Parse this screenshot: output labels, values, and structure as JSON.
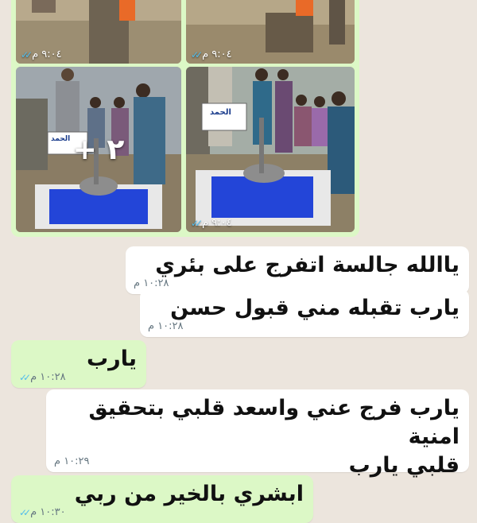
{
  "media": {
    "tiles": [
      {
        "time": "٩:٠٤ م"
      },
      {
        "time": "٩:٠٤ م"
      },
      {
        "time": "",
        "sign_text": "الحمد",
        "more_count": "+ ٢"
      },
      {
        "time": "٩:٠٤ م",
        "sign_text": "الحمد"
      }
    ]
  },
  "messages": [
    {
      "direction": "incoming",
      "text": "ياالله جالسة اتفرج على بئري",
      "time": "١٠:٢٨ م"
    },
    {
      "direction": "incoming",
      "text": "يارب تقبله مني قبول حسن",
      "time": "١٠:٢٨ م"
    },
    {
      "direction": "outgoing",
      "text": "يارب",
      "time": "١٠:٢٨ م",
      "status": "read"
    },
    {
      "direction": "incoming",
      "text_line1": "يارب فرج عني واسعد قلبي بتحقيق امنية",
      "text_line2": "قلبي يارب",
      "time": "١٠:٢٩ م"
    },
    {
      "direction": "outgoing",
      "text": "ابشري بالخير من ربي",
      "time": "١٠:٣٠ م",
      "status": "read"
    }
  ],
  "colors": {
    "background": "#ece5dd",
    "incoming": "#ffffff",
    "outgoing": "#dcf8c6",
    "tick": "#53bdeb"
  }
}
